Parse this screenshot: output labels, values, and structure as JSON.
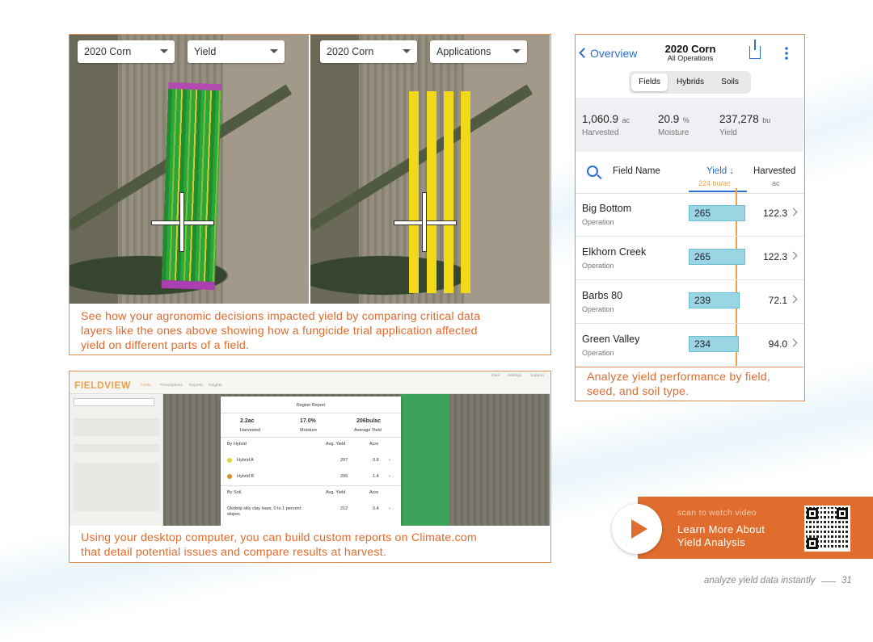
{
  "map_panel": {
    "left_map": {
      "crop_dropdown": "2020 Corn",
      "layer_dropdown": "Yield"
    },
    "right_map": {
      "crop_dropdown": "2020 Corn",
      "layer_dropdown": "Applications"
    },
    "caption": [
      "See how your agronomic decisions impacted yield by comparing critical data",
      "layers like the ones above showing how a fungicide trial application affected",
      "yield on different parts of a field."
    ]
  },
  "desktop_panel": {
    "app_logo": "FIELDVIEW",
    "nav": [
      "Fields",
      "Prescriptions",
      "Reports",
      "Insights"
    ],
    "top_right_links": [
      "Data",
      "Settings",
      "Support"
    ],
    "report": {
      "title": "Region Report",
      "summary": [
        {
          "value": "2.2ac",
          "label": "Harvested"
        },
        {
          "value": "17.0%",
          "label": "Moisture"
        },
        {
          "value": "206bu/ac",
          "label": "Average Yield"
        }
      ],
      "hybrid_header": "By Hybrid",
      "col_avg_yield": "Avg. Yield",
      "col_acre": "Acre",
      "hybrids": [
        {
          "name": "Hybrid A",
          "yield": "207",
          "acre": "0.8",
          "color": "#e8d23a"
        },
        {
          "name": "Hybrid B",
          "yield": "206",
          "acre": "1.4",
          "color": "#e58a2c"
        }
      ],
      "soil_header": "By Soil",
      "soils": [
        {
          "name": "Okoboji silty clay loam, 0 to 1 percent slopes",
          "yield": "212",
          "acre": "0.4"
        }
      ]
    },
    "caption": [
      "Using your desktop computer, you can build custom reports on Climate.com",
      "that detail potential issues and compare results at harvest."
    ]
  },
  "phone": {
    "back_label": "Overview",
    "title": "2020 Corn",
    "subtitle": "All Operations",
    "segments": [
      "Fields",
      "Hybrids",
      "Soils"
    ],
    "active_segment": "Fields",
    "stats": [
      {
        "value": "1,060.9",
        "unit": "ac",
        "label": "Harvested"
      },
      {
        "value": "20.9",
        "unit": "%",
        "label": "Moisture"
      },
      {
        "value": "237,278",
        "unit": "bu",
        "label": "Yield"
      }
    ],
    "col_field_name": "Field Name",
    "col_yield": "Yield",
    "col_yield_sub": "224 bu/ac",
    "col_harvested": "Harvested",
    "col_harvested_sub": "ac",
    "rows": [
      {
        "name": "Big Bottom",
        "sub": "Operation",
        "yield": "265",
        "harvested": "122.3"
      },
      {
        "name": "Elkhorn Creek",
        "sub": "Operation",
        "yield": "265",
        "harvested": "122.3"
      },
      {
        "name": "Barbs 80",
        "sub": "Operation",
        "yield": "239",
        "harvested": "72.1"
      },
      {
        "name": "Green Valley",
        "sub": "Operation",
        "yield": "234",
        "harvested": "94.0"
      }
    ],
    "caption": [
      "Analyze yield performance by field,",
      "seed, and soil type."
    ]
  },
  "cta": {
    "kicker": "scan to watch video",
    "line1": "Learn More About",
    "line2": "Yield Analysis"
  },
  "footer": {
    "text": "analyze yield data instantly",
    "page": "31"
  },
  "colors": {
    "accent": "#e06d2d",
    "link_blue": "#2a6fd0",
    "bar_blue": "#9ad5e3",
    "avg_line": "#f0a33a"
  }
}
